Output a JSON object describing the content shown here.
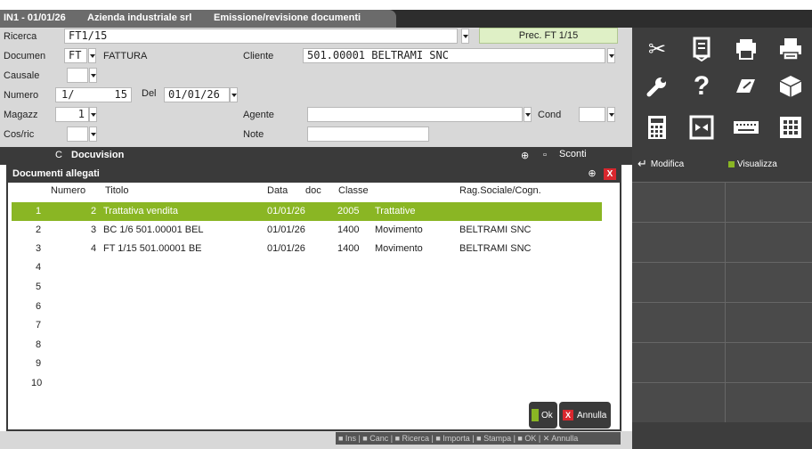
{
  "window": {
    "tab_1": "IN1 - 01/01/26",
    "tab_2": "Azienda industriale srl",
    "tab_3": "Emissione/revisione documenti"
  },
  "form": {
    "ricerca_label": "Ricerca",
    "ricerca_value": "FT1/15",
    "prec_label": "Prec. FT 1/15",
    "documen_label": "Documen",
    "documen_code": "FT",
    "documen_desc": "FATTURA",
    "cliente_label": "Cliente",
    "cliente_value": "501.00001 BELTRAMI SNC",
    "causale_label": "Causale",
    "numero_label": "Numero",
    "numero_part1": "1/",
    "numero_part2": "15",
    "del_label": "Del",
    "del_value": "01/01/26",
    "magazz_label": "Magazz",
    "magazz_value": "1",
    "agente_label": "Agente",
    "cond_label": "Cond",
    "cosric_label": "Cos/ric",
    "note_label": "Note",
    "sconti_label": "Sconti",
    "c_label": "C"
  },
  "docuvision": {
    "title": "Docuvision"
  },
  "dialog": {
    "title": "Documenti allegati",
    "close_label": "X",
    "columns": [
      "Numero",
      "Titolo",
      "Data",
      "doc",
      "Classe",
      "Rag.Sociale/Cogn."
    ],
    "rows": [
      {
        "idx": "1",
        "num": "2",
        "titolo": "Trattativa vendita",
        "data": "01/01/26",
        "classe": "2005",
        "classe_desc": "Trattative",
        "rag": ""
      },
      {
        "idx": "2",
        "num": "3",
        "titolo": "BC 1/6 501.00001 BEL",
        "data": "01/01/26",
        "classe": "1400",
        "classe_desc": "Movimento",
        "rag": "BELTRAMI SNC"
      },
      {
        "idx": "3",
        "num": "4",
        "titolo": "FT 1/15 501.00001 BE",
        "data": "01/01/26",
        "classe": "1400",
        "classe_desc": "Movimento",
        "rag": "BELTRAMI SNC"
      },
      {
        "idx": "4"
      },
      {
        "idx": "5"
      },
      {
        "idx": "6"
      },
      {
        "idx": "7"
      },
      {
        "idx": "8"
      },
      {
        "idx": "9"
      },
      {
        "idx": "10"
      }
    ],
    "ok_label": "Ok",
    "annulla_label": "Annulla",
    "annulla_icon": "X"
  },
  "right_panel": {
    "modifica_label": "Modifica",
    "visualizza_label": "Visualizza",
    "icons": [
      "scissors-icon",
      "document-stack-icon",
      "print-preview-icon",
      "printer-icon",
      "wrench-icon",
      "help-icon",
      "edit-note-icon",
      "cube-icon",
      "calculator-icon",
      "expand-icon",
      "keyboard-icon",
      "grid-icon"
    ],
    "help_glyph": "?"
  },
  "function_keys": "■ Ins | ■ Canc | ■ Ricerca | ■ Importa | ■ Stampa | ■ OK | ✕ Annulla",
  "colors": {
    "selected_row": "#8ab624",
    "accent_red": "#d9272e",
    "panel_dark": "#3d3d3d",
    "form_bg": "#d8d8d8"
  }
}
